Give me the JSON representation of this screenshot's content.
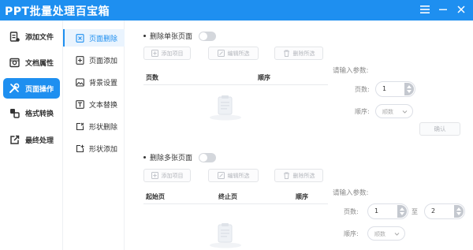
{
  "app": {
    "title": "PPT批量处理百宝箱"
  },
  "sidebar": {
    "items": [
      {
        "label": "添加文件",
        "icon": "file-add-icon",
        "active": false
      },
      {
        "label": "文档属性",
        "icon": "doc-properties-icon",
        "active": false
      },
      {
        "label": "页面操作",
        "icon": "tools-icon",
        "active": true
      },
      {
        "label": "格式转换",
        "icon": "convert-icon",
        "active": false
      },
      {
        "label": "最终处理",
        "icon": "export-icon",
        "active": false
      }
    ]
  },
  "subnav": {
    "items": [
      {
        "label": "页面删除",
        "icon": "page-delete-icon",
        "active": true
      },
      {
        "label": "页面添加",
        "icon": "page-add-icon",
        "active": false
      },
      {
        "label": "背景设置",
        "icon": "background-icon",
        "active": false
      },
      {
        "label": "文本替换",
        "icon": "text-replace-icon",
        "active": false
      },
      {
        "label": "形状删除",
        "icon": "shape-delete-icon",
        "active": false
      },
      {
        "label": "形状添加",
        "icon": "shape-add-icon",
        "active": false
      }
    ]
  },
  "single": {
    "title": "删除单张页面",
    "toolbar": {
      "add": "添加项目",
      "edit": "编辑所选",
      "delete": "删除所选"
    },
    "columns": [
      "页数",
      "顺序"
    ],
    "params": {
      "title": "请输入参数:",
      "page_label": "页数:",
      "page_value": "1",
      "order_label": "顺序:",
      "order_placeholder": "顺数"
    },
    "confirm": "确认"
  },
  "multiple": {
    "title": "删除多张页面",
    "toolbar": {
      "add": "添加项目",
      "edit": "编辑所选",
      "delete": "删除所选"
    },
    "columns": [
      "起始页",
      "终止页",
      "顺序"
    ],
    "params": {
      "title": "请输入参数:",
      "page_label": "页数:",
      "from_value": "1",
      "to_label": "至",
      "to_value": "2",
      "order_label": "顺序:",
      "order_placeholder": "顺数"
    }
  },
  "colors": {
    "accent": "#1e8ff0",
    "accent_light": "#eaf4fe",
    "disabled_text": "#b3b6bc"
  }
}
